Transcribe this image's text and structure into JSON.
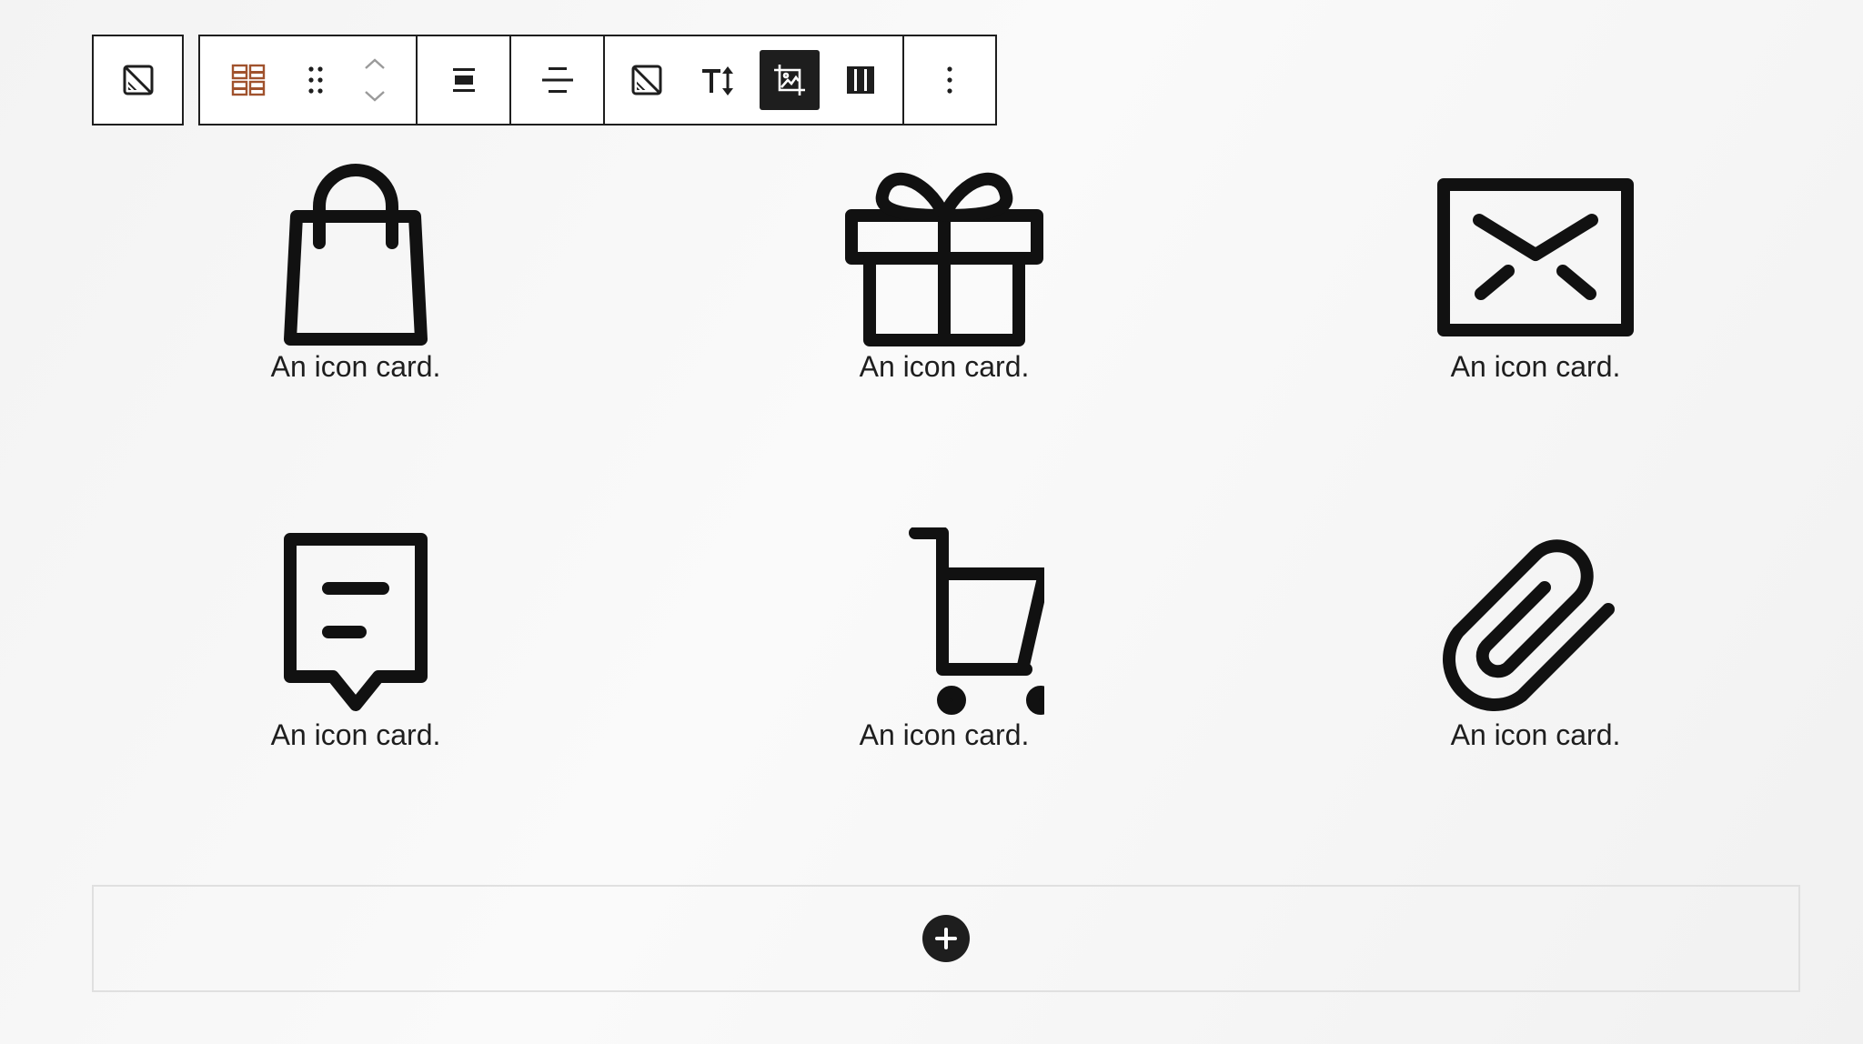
{
  "toolbar": {
    "parent_block": {
      "icon": "image-placeholder-icon"
    },
    "block": [
      {
        "buttons": [
          {
            "icon": "grid-block-icon"
          },
          {
            "icon": "drag-handle-icon"
          },
          {
            "icon": "move-up-down-icon"
          }
        ]
      },
      {
        "buttons": [
          {
            "icon": "align-center-icon"
          }
        ]
      },
      {
        "buttons": [
          {
            "icon": "justify-icon"
          }
        ]
      },
      {
        "buttons": [
          {
            "icon": "image-placeholder-icon"
          },
          {
            "icon": "text-size-icon"
          },
          {
            "icon": "crop-icon",
            "active": true
          },
          {
            "icon": "columns-icon"
          }
        ]
      },
      {
        "buttons": [
          {
            "icon": "more-options-icon"
          }
        ]
      }
    ]
  },
  "cards": [
    {
      "icon": "shopping-bag-icon",
      "caption": "An icon card."
    },
    {
      "icon": "gift-icon",
      "caption": "An icon card."
    },
    {
      "icon": "envelope-icon",
      "caption": "An icon card."
    },
    {
      "icon": "comment-icon",
      "caption": "An icon card."
    },
    {
      "icon": "cart-icon",
      "caption": "An icon card."
    },
    {
      "icon": "paperclip-icon",
      "caption": "An icon card."
    }
  ],
  "appender": {
    "icon": "plus-icon"
  },
  "colors": {
    "ink": "#1e1e1e",
    "grid_icon": "#a0522d",
    "background": "#f5f5f5"
  }
}
